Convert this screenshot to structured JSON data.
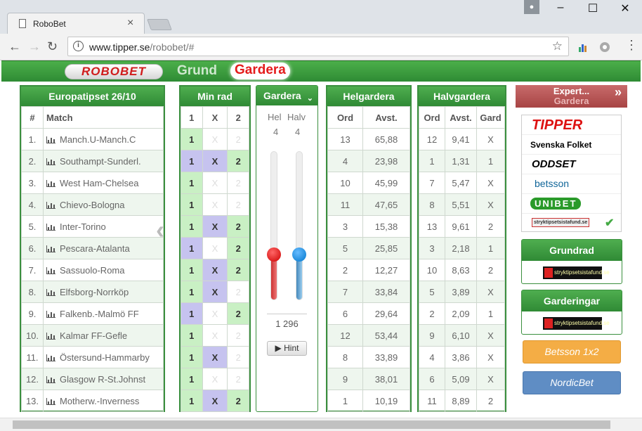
{
  "browser": {
    "tab_title": "RoboBet",
    "url_host": "www.tipper.se",
    "url_path": "/robobet/#"
  },
  "brand": {
    "logo": "ROBOBET",
    "nav_grund": "Grund",
    "nav_gardera": "Gardera"
  },
  "coupon": {
    "title": "Europatipset 26/10",
    "col_num": "#",
    "col_match": "Match",
    "matches": [
      "Manch.U-Manch.C",
      "Southampt-Sunderl.",
      "West Ham-Chelsea",
      "Chievo-Bologna",
      "Inter-Torino",
      "Pescara-Atalanta",
      "Sassuolo-Roma",
      "Elfsborg-Norrköp",
      "Falkenb.-Malmö FF",
      "Kalmar FF-Gefle",
      "Östersund-Hammarby",
      "Glasgow R-St.Johnst",
      "Motherw.-Inverness"
    ]
  },
  "minrad": {
    "title": "Min rad",
    "cols": [
      "1",
      "X",
      "2"
    ],
    "rows": [
      [
        1,
        0,
        0
      ],
      [
        2,
        1,
        1
      ],
      [
        1,
        0,
        0
      ],
      [
        1,
        0,
        0
      ],
      [
        1,
        1,
        1
      ],
      [
        2,
        0,
        1
      ],
      [
        1,
        1,
        1
      ],
      [
        1,
        1,
        0
      ],
      [
        2,
        0,
        1
      ],
      [
        1,
        0,
        0
      ],
      [
        1,
        1,
        0
      ],
      [
        1,
        0,
        0
      ],
      [
        1,
        1,
        1
      ]
    ]
  },
  "gardera": {
    "title": "Gardera",
    "hel_label": "Hel",
    "halv_label": "Halv",
    "hel_value": "4",
    "halv_value": "4",
    "combos": "1 296",
    "hint": "▶ Hint"
  },
  "helgardera": {
    "title": "Helgardera",
    "col_ord": "Ord",
    "col_avst": "Avst.",
    "rows": [
      [
        "13",
        "65,88"
      ],
      [
        "4",
        "23,98"
      ],
      [
        "10",
        "45,99"
      ],
      [
        "11",
        "47,65"
      ],
      [
        "3",
        "15,38"
      ],
      [
        "5",
        "25,85"
      ],
      [
        "2",
        "12,27"
      ],
      [
        "7",
        "33,84"
      ],
      [
        "6",
        "29,64"
      ],
      [
        "12",
        "53,44"
      ],
      [
        "8",
        "33,89"
      ],
      [
        "9",
        "38,01"
      ],
      [
        "1",
        "10,19"
      ]
    ]
  },
  "halvgardera": {
    "title": "Halvgardera",
    "col_ord": "Ord",
    "col_avst": "Avst.",
    "col_gard": "Gard",
    "rows": [
      [
        "12",
        "9,41",
        "X"
      ],
      [
        "1",
        "1,31",
        "1"
      ],
      [
        "7",
        "5,47",
        "X"
      ],
      [
        "8",
        "5,51",
        "X"
      ],
      [
        "13",
        "9,61",
        "2"
      ],
      [
        "3",
        "2,18",
        "1"
      ],
      [
        "10",
        "8,63",
        "2"
      ],
      [
        "5",
        "3,89",
        "X"
      ],
      [
        "2",
        "2,09",
        "1"
      ],
      [
        "9",
        "6,10",
        "X"
      ],
      [
        "4",
        "3,86",
        "X"
      ],
      [
        "6",
        "5,09",
        "X"
      ],
      [
        "11",
        "8,89",
        "2"
      ]
    ]
  },
  "sidebar": {
    "expert_title": "Expert...",
    "expert_sub": "Gardera",
    "bookmakers": [
      "TIPPER",
      "Svenska Folket",
      "ODDSET",
      "betsson",
      "UNIBET",
      "stryktipsetsistafund.se"
    ],
    "grundrad": "Grundrad",
    "garderingar": "Garderingar",
    "mini_logo": "stryktipsetsistafund.se",
    "betsson_btn": "Betsson 1x2",
    "nordic_btn": "NordicBet"
  },
  "colors": {
    "green": "#3a8f3e",
    "sel1": "#c9f0c4",
    "selX": "#c6c3ef",
    "red": "#d01c1c"
  }
}
